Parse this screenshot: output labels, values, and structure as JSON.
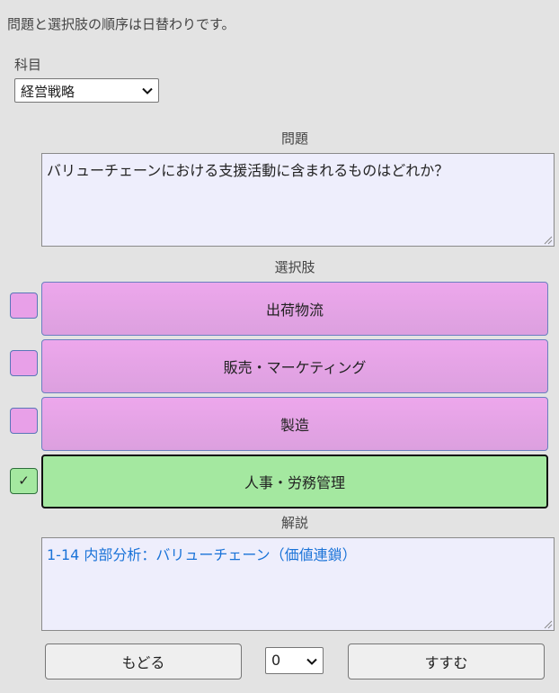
{
  "notice": "問題と選択肢の順序は日替わりです。",
  "subject": {
    "label": "科目",
    "selected": "経営戦略"
  },
  "question": {
    "label": "問題",
    "text": "バリューチェーンにおける支援活動に含まれるものはどれか？"
  },
  "choices": {
    "label": "選択肢",
    "items": [
      {
        "label": "出荷物流",
        "checked": false,
        "check_mark": ""
      },
      {
        "label": "販売・マーケティング",
        "checked": false,
        "check_mark": ""
      },
      {
        "label": "製造",
        "checked": false,
        "check_mark": ""
      },
      {
        "label": "人事・労務管理",
        "checked": true,
        "check_mark": "✓"
      }
    ]
  },
  "explanation": {
    "label": "解説",
    "text": "1-14 内部分析：バリューチェーン（価値連鎖）"
  },
  "nav": {
    "back_label": "もどる",
    "page_value": "0",
    "next_label": "すすむ"
  },
  "colors": {
    "choice_default": "#e8a0e8",
    "choice_selected": "#a4e8a0",
    "explanation_text": "#1a73d8"
  }
}
